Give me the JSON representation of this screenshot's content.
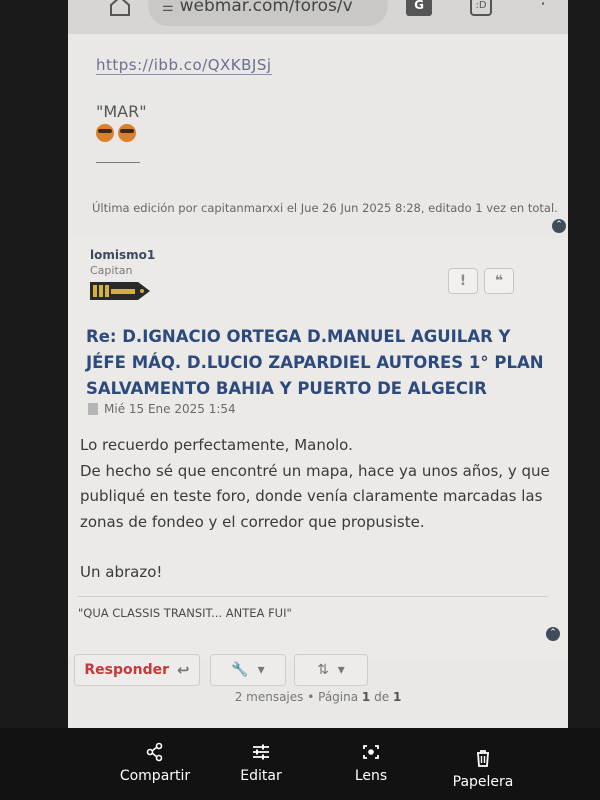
{
  "browser": {
    "url": "webmar.com/foros/v",
    "tabs_count": ":D"
  },
  "post1": {
    "link": "https://ibb.co/QXKBJSj",
    "signature_name": "\"MAR\"",
    "edit_note": "Última edición por capitanmarxxi el Jue 26 Jun 2025 8:28, editado 1 vez en total."
  },
  "post2": {
    "author": "lomismo1",
    "rank": "Capitan",
    "title": "Re: D.IGNACIO ORTEGA D.MANUEL AGUILAR Y JÉFE MÁQ. D.LUCIO ZAPARDIEL AUTORES 1° PLAN SALVAMENTO BAHIA Y PUERTO DE ALGECIR",
    "date": "Mié 15 Ene 2025 1:54",
    "body": [
      "Lo recuerdo perfectamente, Manolo.",
      "De hecho sé que encontré un mapa, hace ya unos años, y que publiqué en teste foro, donde venía claramente marcadas las zonas de fondeo y el corredor que propusiste.",
      "",
      "Un abrazo!"
    ],
    "signature": "\"QUA CLASSIS TRANSIT... ANTEA FUI\""
  },
  "toolbar": {
    "reply_label": "Responder"
  },
  "pagination": {
    "messages": "2 mensajes",
    "page_prefix": "Página",
    "current": "1",
    "of": "de",
    "total": "1"
  },
  "actionbar": {
    "items": [
      "Compartir",
      "Editar",
      "Lens",
      "Papelera"
    ]
  }
}
